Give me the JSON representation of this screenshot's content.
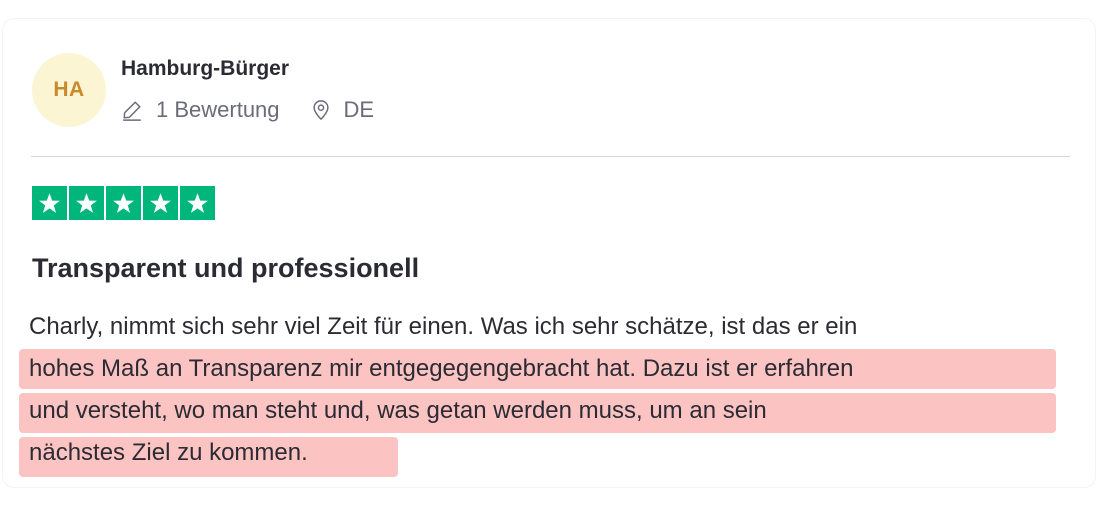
{
  "review": {
    "author": {
      "initials": "HA",
      "name": "Hamburg-Bürger",
      "review_count": "1 Bewertung",
      "country": "DE"
    },
    "rating": 5,
    "title": "Transparent und professionell",
    "body_lines": [
      "Charly, nimmt sich sehr viel Zeit für einen. Was ich sehr schätze, ist das er ein",
      "hohes Maß an Transparenz mir entgegegengebracht hat. Dazu ist er erfahren",
      "und versteht, wo man steht und, was getan werden muss, um an sein",
      "nächstes Ziel zu kommen."
    ],
    "highlighted_lines": [
      1,
      2,
      3
    ]
  },
  "colors": {
    "star_green": "#00b67a",
    "avatar_bg": "#fbf5d3",
    "avatar_text": "#c88a2c",
    "highlight": "#fcc3c3",
    "meta_text": "#6b6b7a"
  },
  "icons": {
    "review_count": "pencil-icon",
    "country": "location-pin-icon",
    "rating": "star-icon"
  }
}
